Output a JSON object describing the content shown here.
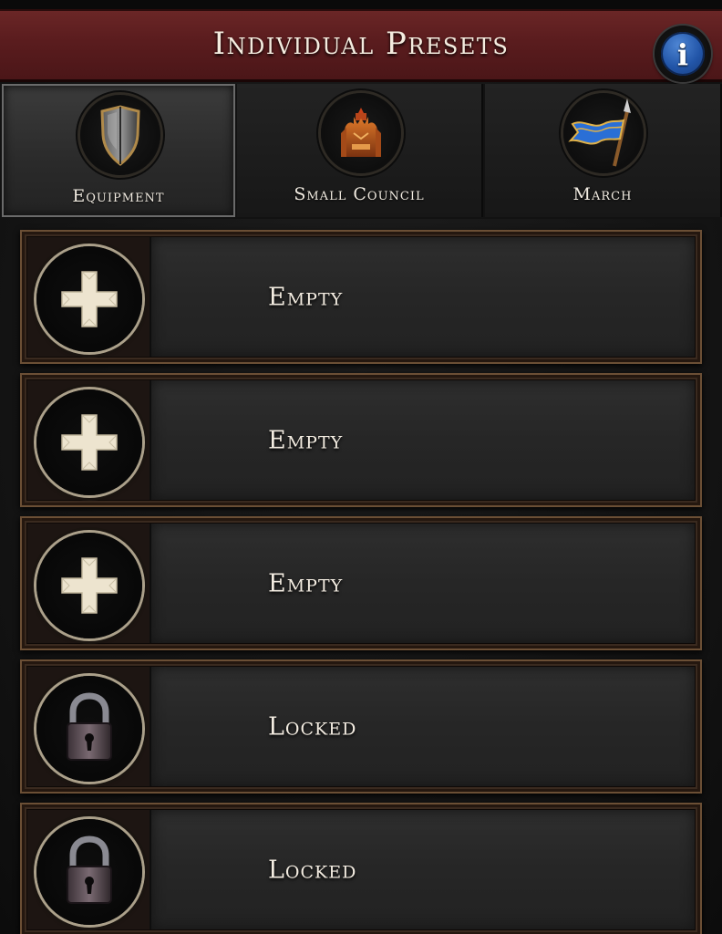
{
  "header": {
    "title": "Individual Presets",
    "info_icon": "info-icon",
    "info_glyph": "i"
  },
  "tabs": [
    {
      "label": "Equipment",
      "icon": "shield-icon",
      "active": true
    },
    {
      "label": "Small Council",
      "icon": "throne-icon",
      "active": false
    },
    {
      "label": "March",
      "icon": "banner-flag-icon",
      "active": false
    }
  ],
  "presets": [
    {
      "label": "Empty",
      "icon": "plus-icon",
      "state": "empty"
    },
    {
      "label": "Empty",
      "icon": "plus-icon",
      "state": "empty"
    },
    {
      "label": "Empty",
      "icon": "plus-icon",
      "state": "empty"
    },
    {
      "label": "Locked",
      "icon": "padlock-icon",
      "state": "locked"
    },
    {
      "label": "Locked",
      "icon": "padlock-icon",
      "state": "locked"
    }
  ],
  "colors": {
    "header_bg": "#5a1c1e",
    "row_border": "#6b4f35",
    "info_blue": "#2255a8",
    "banner_blue": "#2a6fd6",
    "banner_gold": "#e0b24a"
  }
}
